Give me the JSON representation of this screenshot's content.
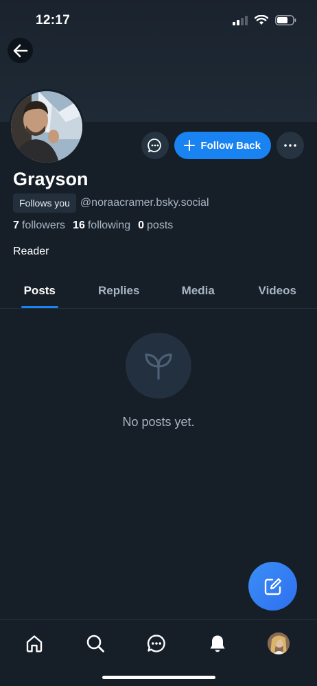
{
  "status_bar": {
    "time": "12:17"
  },
  "profile": {
    "display_name": "Grayson",
    "follows_you_badge": "Follows you",
    "handle": "@noraacramer.bsky.social",
    "stats": {
      "followers_count": "7",
      "followers_label": "followers",
      "following_count": "16",
      "following_label": "following",
      "posts_count": "0",
      "posts_label": "posts"
    },
    "bio": "Reader"
  },
  "actions": {
    "follow_back_label": "Follow Back"
  },
  "tabs": [
    {
      "label": "Posts",
      "active": true
    },
    {
      "label": "Replies",
      "active": false
    },
    {
      "label": "Media",
      "active": false
    },
    {
      "label": "Videos",
      "active": false
    }
  ],
  "empty_state": {
    "message": "No posts yet.",
    "icon": "sprout-icon"
  },
  "bottom_nav": {
    "items": [
      "home-icon",
      "search-icon",
      "chat-icon",
      "bell-icon",
      "profile-avatar"
    ]
  },
  "colors": {
    "accent": "#1a83f2",
    "background": "#161e27",
    "muted_text": "#a7b6c4"
  }
}
